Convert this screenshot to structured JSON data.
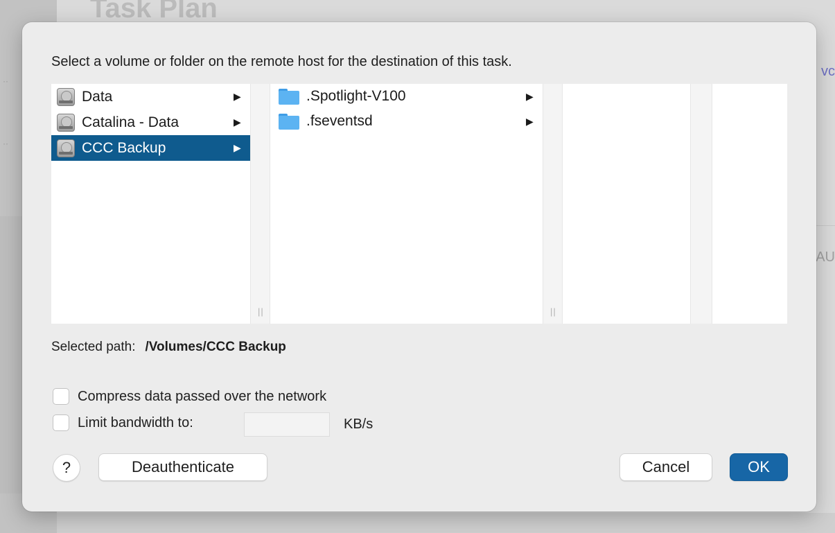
{
  "background": {
    "title": "Task Plan",
    "link_fragment": "vc",
    "label_fragment": "AU"
  },
  "dialog": {
    "prompt": "Select a volume or folder on the remote host for the destination of this task.",
    "columns": {
      "volumes": [
        {
          "label": "Data",
          "icon": "disk-icon",
          "selected": false
        },
        {
          "label": "Catalina - Data",
          "icon": "disk-icon",
          "selected": false
        },
        {
          "label": "CCC Backup",
          "icon": "disk-icon",
          "selected": true
        }
      ],
      "folders": [
        {
          "label": ".Spotlight-V100",
          "icon": "folder-icon"
        },
        {
          "label": ".fseventsd",
          "icon": "folder-icon"
        }
      ]
    },
    "selected_path_label": "Selected path:",
    "selected_path_value": "/Volumes/CCC Backup",
    "compress_label": "Compress data passed over the network",
    "compress_checked": false,
    "limit_label": "Limit bandwidth to:",
    "limit_checked": false,
    "limit_value": "",
    "limit_unit": "KB/s",
    "help_label": "?",
    "deauth_label": "Deauthenticate",
    "cancel_label": "Cancel",
    "ok_label": "OK",
    "colors": {
      "selection": "#0f5b8e",
      "ok_button": "#1766a6",
      "folder": "#5cb3f2"
    }
  }
}
